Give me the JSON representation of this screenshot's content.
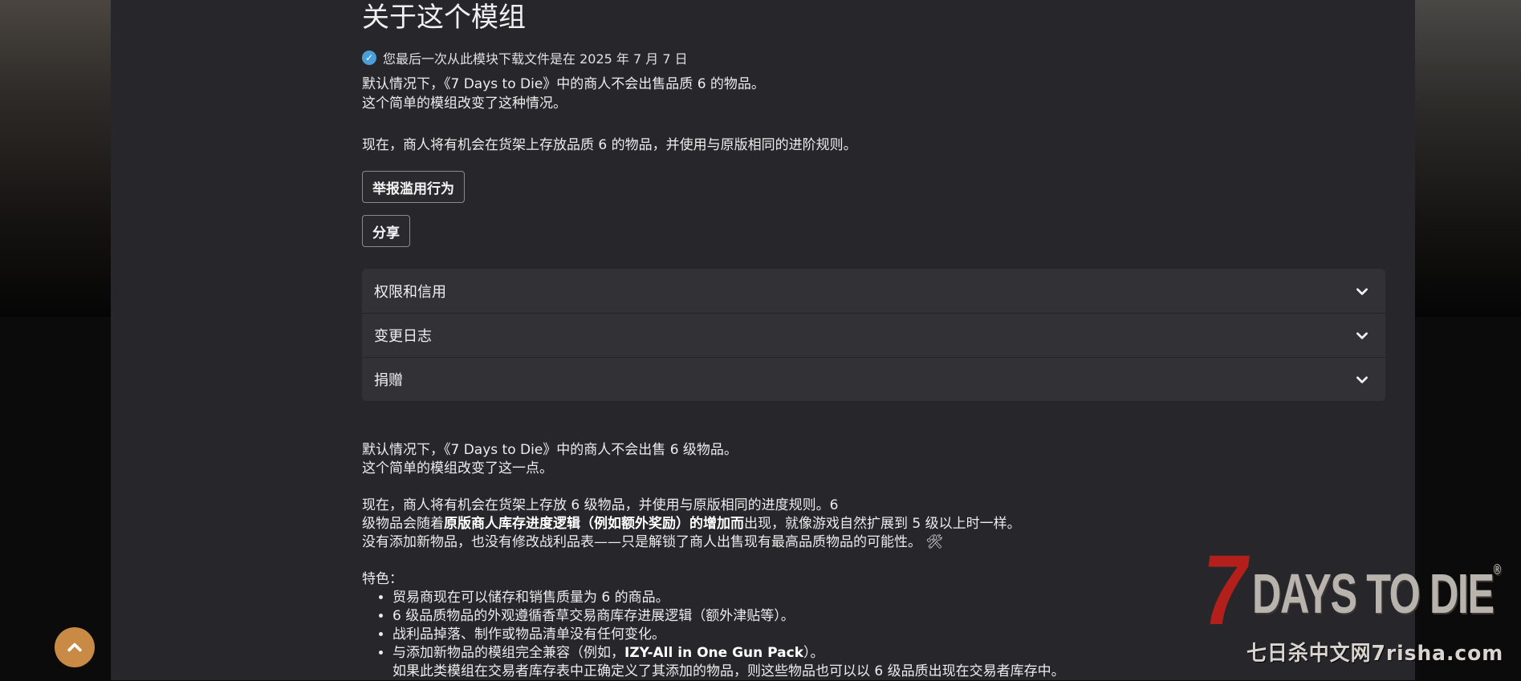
{
  "mod": {
    "heading": "关于这个模组",
    "download_notice": "您最后一次从此模块下载文件是在 2025 年 7 月 7 日",
    "summary_lines": [
      "默认情况下，《7 Days to Die》中的商人不会出售品质 6 的物品。",
      "这个简单的模组改变了这种情况。",
      "",
      "现在，商人将有机会在货架上存放品质 6 的物品，并使用与原版相同的进阶规则。"
    ]
  },
  "actions": {
    "report_label": "举报滥用行为",
    "share_label": "分享"
  },
  "accordion": [
    {
      "label": "权限和信用"
    },
    {
      "label": "变更日志"
    },
    {
      "label": "捐赠"
    }
  ],
  "description": {
    "p1_line1": "默认情况下，《7 Days to Die》中的商人不会出售 6 级物品。",
    "p1_line2": "这个简单的模组改变了这一点。",
    "p2_line1": "现在，商人将有机会在货架上存放 6 级物品，并使用与原版相同的进度规则。6",
    "p2_line2_pre": "级物品会随着",
    "p2_line2_bold": "原版商人库存进度逻辑（例如额外奖励）的增加而",
    "p2_line2_post": "出现，就像游戏自然扩展到 5 级以上时一样。",
    "p2_line3": "没有添加新物品，也没有修改战利品表——只是解锁了商人出售现有最高品质物品的可能性。 🛠",
    "features_label": "特色：",
    "features": {
      "f1": "贸易商现在可以储存和销售质量为 6 的商品。",
      "f2": "6 级品质物品的外观遵循香草交易商库存进展逻辑（额外津贴等）。",
      "f3": "战利品掉落、制作或物品清单没有任何变化。",
      "f4_pre": "与添加新物品的模组完全兼容（例如，",
      "f4_bold": "IZY-All in One Gun Pack",
      "f4_post": "）。",
      "f4_cont": "如果此类模组在交易者库存表中正确定义了其添加的物品，则这些物品也可以以 6 级品质出现在交易者库存中。"
    }
  },
  "watermark": {
    "seven": "7",
    "title": "DAYS TO DIE",
    "registered": "®",
    "sub": "七日杀中文网7risha.com"
  },
  "colors": {
    "panel": "#27272b",
    "accordion": "#323236",
    "scroll_top_button": "#c98a45",
    "check_badge": "#4a9fd8"
  },
  "icons": {
    "download_badge": "check-circle-icon",
    "accordion_toggle": "chevron-down-icon",
    "scroll_top": "chevron-up-icon"
  }
}
